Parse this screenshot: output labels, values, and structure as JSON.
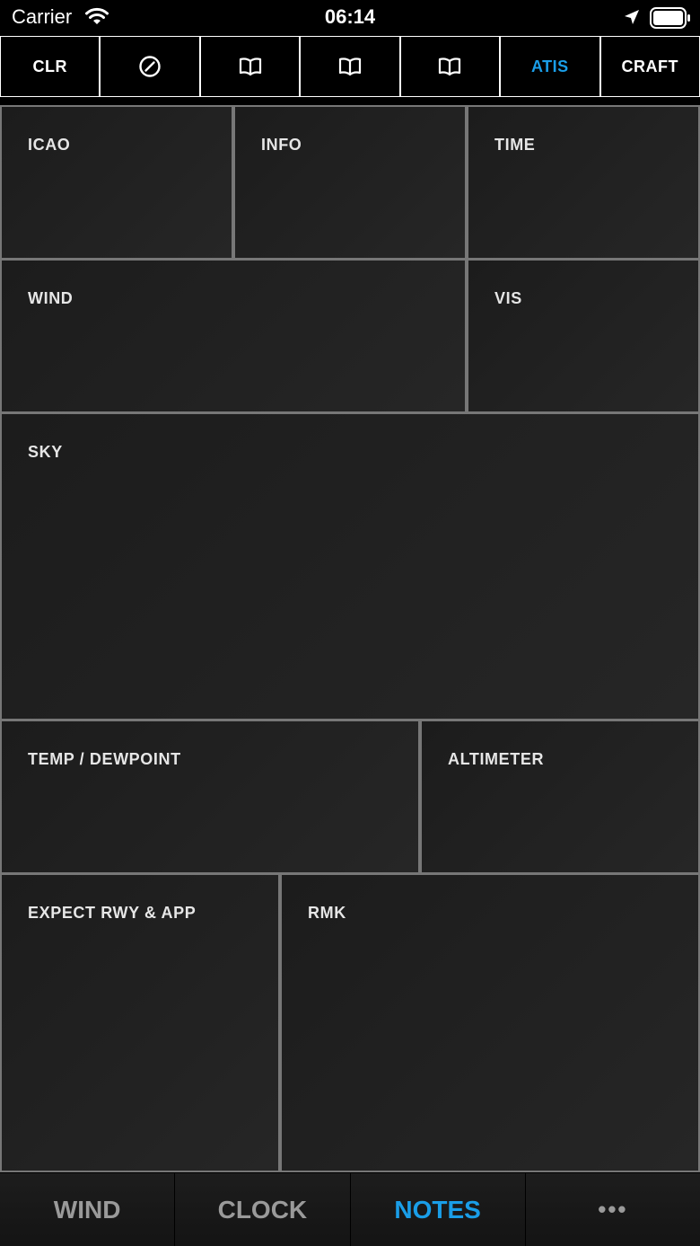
{
  "status_bar": {
    "carrier": "Carrier",
    "time": "06:14"
  },
  "toolbar": {
    "items": [
      {
        "label": "CLR",
        "icon": null
      },
      {
        "label": "",
        "icon": "slash-circle-icon"
      },
      {
        "label": "",
        "icon": "book-icon"
      },
      {
        "label": "",
        "icon": "book-icon"
      },
      {
        "label": "",
        "icon": "book-icon"
      },
      {
        "label": "ATIS",
        "icon": null,
        "active": true
      },
      {
        "label": "CRAFT",
        "icon": null
      }
    ]
  },
  "fields": {
    "icao": "ICAO",
    "info": "INFO",
    "time": "TIME",
    "wind": "WIND",
    "vis": "VIS",
    "sky": "SKY",
    "temp_dewpoint": "TEMP / DEWPOINT",
    "altimeter": "ALTIMETER",
    "expect_rwy_app": "EXPECT RWY & APP",
    "rmk": "RMK"
  },
  "tabbar": {
    "items": [
      {
        "label": "WIND"
      },
      {
        "label": "CLOCK"
      },
      {
        "label": "NOTES",
        "active": true
      },
      {
        "label": "•••"
      }
    ]
  },
  "colors": {
    "accent": "#1a9ee8",
    "background": "#000000",
    "cell": "#1f1f1f",
    "divider": "#777777",
    "tab_inactive": "#9a9a9a"
  }
}
